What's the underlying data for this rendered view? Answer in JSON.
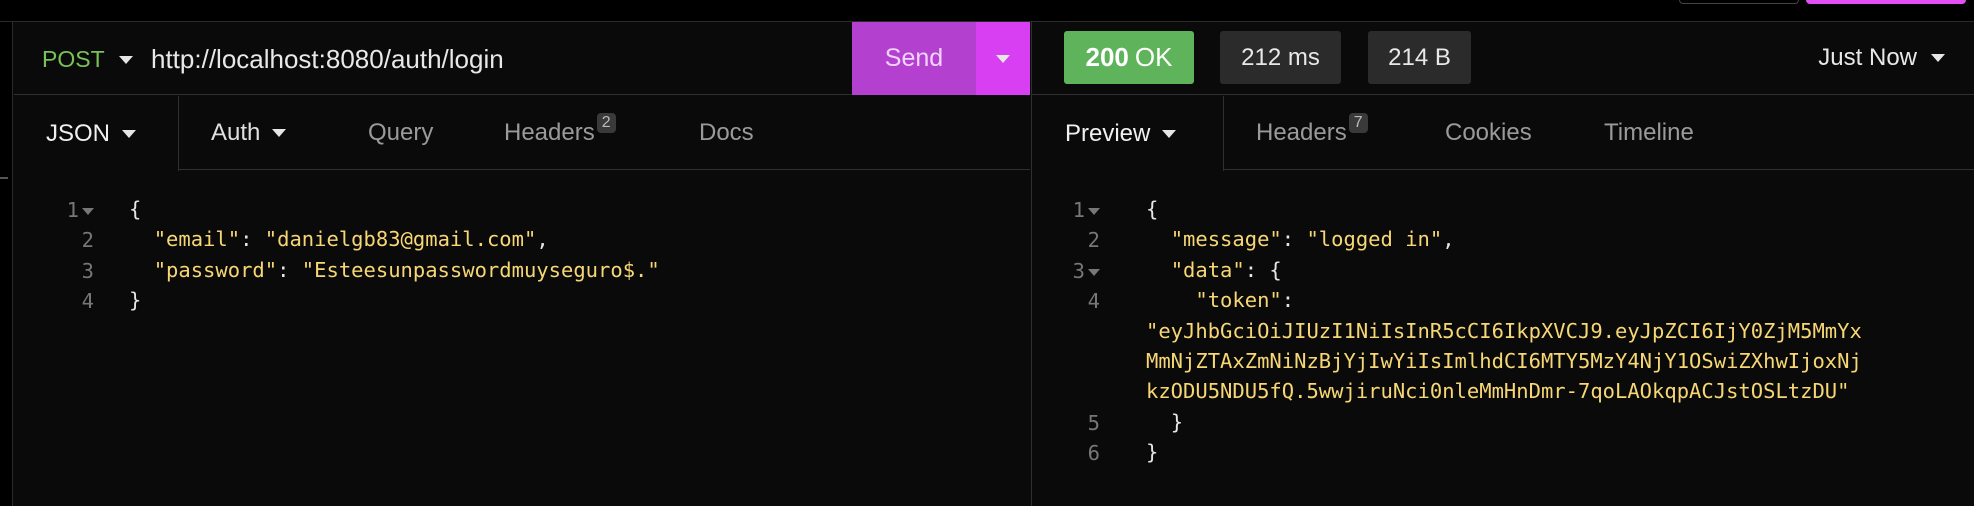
{
  "request": {
    "method": "POST",
    "url": "http://localhost:8080/auth/login",
    "send_label": "Send",
    "tabs": [
      {
        "label": "JSON"
      },
      {
        "label": "Auth"
      },
      {
        "label": "Query"
      },
      {
        "label": "Headers",
        "badge": "2"
      },
      {
        "label": "Docs"
      }
    ],
    "body_lines": [
      {
        "n": "1",
        "text": "{"
      },
      {
        "n": "2",
        "key": "\"email\"",
        "sep": ": ",
        "val": "\"danielgb83@gmail.com\"",
        "end": ","
      },
      {
        "n": "3",
        "key": "\"password\"",
        "sep": ": ",
        "val": "\"Esteesunpasswordmuyseguro$.\"",
        "end": ""
      },
      {
        "n": "4",
        "text": "}"
      }
    ]
  },
  "response": {
    "status_code": "200",
    "status_text": "OK",
    "time": "212 ms",
    "size": "214 B",
    "history_label": "Just Now",
    "tabs": [
      {
        "label": "Preview"
      },
      {
        "label": "Headers",
        "badge": "7"
      },
      {
        "label": "Cookies"
      },
      {
        "label": "Timeline"
      }
    ],
    "body": {
      "l1": "{",
      "message_key": "\"message\"",
      "message_val": "\"logged in\"",
      "data_key": "\"data\"",
      "token_key": "\"token\"",
      "token_1": "\"eyJhbGciOiJIUzI1NiIsInR5cCI6IkpXVCJ9.eyJpZCI6IjY0ZjM5MmYx",
      "token_2": "MmNjZTAxZmNiNzBjYjIwYiIsImlhdCI6MTY5MzY4NjY1OSwiZXhwIjoxNj",
      "token_3": "kzODU5NDU5fQ.5wwjiruNci0nleMmHnDmr-7qoLAOkqpACJstOSLtzDU\"",
      "close_inner": "}",
      "close_outer": "}",
      "line_numbers": [
        "1",
        "2",
        "3",
        "4",
        "5",
        "6"
      ]
    }
  },
  "colors": {
    "method": "#78c258",
    "send": "#b440cf",
    "status_ok": "#5fb35a",
    "string": "#f7d774"
  }
}
